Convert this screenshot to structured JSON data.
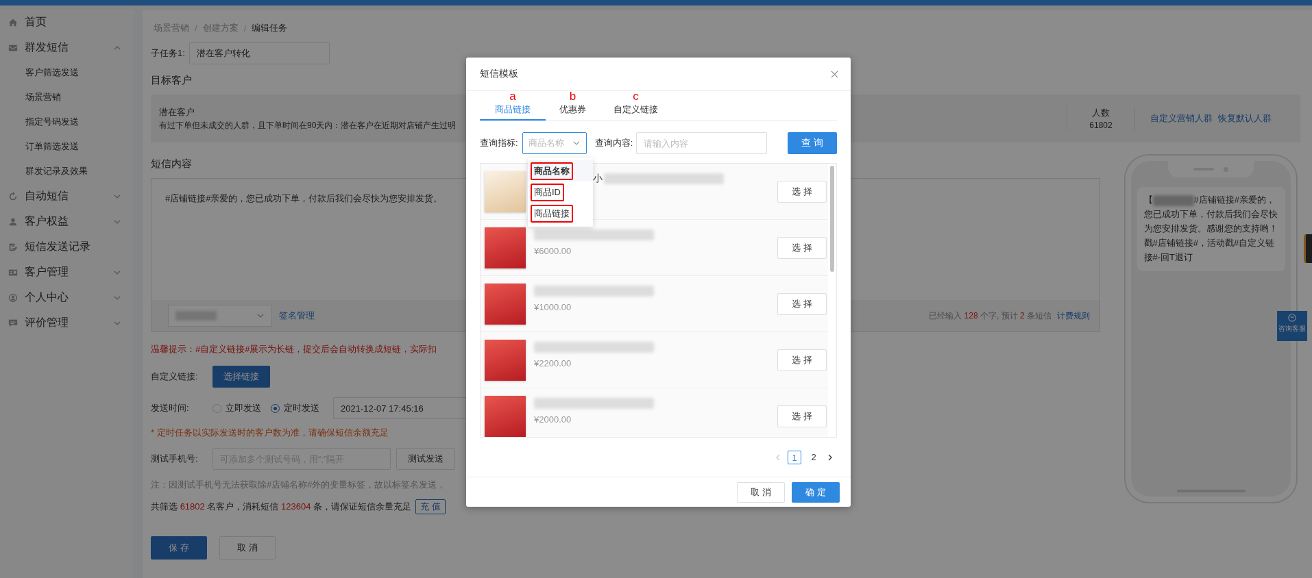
{
  "sidebar": {
    "items": [
      {
        "label": "首页",
        "kind": "link"
      },
      {
        "label": "群发短信",
        "kind": "group",
        "expanded": true,
        "children": [
          {
            "label": "客户筛选发送"
          },
          {
            "label": "场景营销"
          },
          {
            "label": "指定号码发送"
          },
          {
            "label": "订单筛选发送"
          },
          {
            "label": "群发记录及效果"
          }
        ]
      },
      {
        "label": "自动短信",
        "kind": "group",
        "expanded": false
      },
      {
        "label": "客户权益",
        "kind": "group",
        "expanded": false
      },
      {
        "label": "短信发送记录",
        "kind": "link"
      },
      {
        "label": "客户管理",
        "kind": "group",
        "expanded": false
      },
      {
        "label": "个人中心",
        "kind": "group",
        "expanded": false
      },
      {
        "label": "评价管理",
        "kind": "group",
        "expanded": false
      }
    ]
  },
  "breadcrumb": {
    "items": [
      "场景营销",
      "创建方案",
      "编辑任务"
    ],
    "separator": "/"
  },
  "subtask": {
    "label": "子任务1:",
    "value": "潜在客户转化"
  },
  "target": {
    "heading": "目标客户",
    "name": "潜在客户",
    "description": "有过下单但未成交的人群，且下单时间在90天内：潜在客户在近期对店铺产生过明",
    "count_label": "人数",
    "count": "61802",
    "links": [
      "自定义营销人群",
      "恢复默认人群"
    ]
  },
  "content": {
    "heading": "短信内容",
    "text": "#店铺链接#亲爱的，您已成功下单，付款后我们会尽快为您安排发货。",
    "signature_link": "签名管理",
    "counter": [
      {
        "text": "已经输入 ",
        "highlight": false
      },
      {
        "text": "128",
        "highlight": true
      },
      {
        "text": " 个字, 预计 ",
        "highlight": false
      },
      {
        "text": "2",
        "highlight": true
      },
      {
        "text": " 条短信",
        "highlight": false
      }
    ],
    "rules_link": "计费规则"
  },
  "tip": "温馨提示：#自定义链接#展示为长链，提交后会自动转换成短链，实际扣",
  "custom_link": {
    "label": "自定义链接:",
    "button": "选择链接"
  },
  "send_time": {
    "label": "发送时间:",
    "options": [
      {
        "label": "立即发送",
        "selected": false
      },
      {
        "label": "定时发送",
        "selected": true
      }
    ],
    "value": "2021-12-07 17:45:16"
  },
  "schedule_note": "* 定时任务以实际发送时的客户数为准，请确保短信余额充足",
  "test_phone": {
    "label": "测试手机号:",
    "placeholder": "可添加多个测试号码，用“;”隔开",
    "button": "测试发送"
  },
  "test_note": "注：因测试手机号无法获取除#店铺名称#外的变量标签，故以标签名发送，",
  "summary": {
    "parts": [
      {
        "text": "共筛选 ",
        "highlight": false
      },
      {
        "text": "61802",
        "highlight": true
      },
      {
        "text": " 名客户，消耗短信 ",
        "highlight": false
      },
      {
        "text": "123604",
        "highlight": true
      },
      {
        "text": " 条，请保证短信余量充足",
        "highlight": false
      }
    ],
    "button": "充 值"
  },
  "actions": {
    "save": "保 存",
    "cancel": "取 消"
  },
  "phone_preview": {
    "lead": "【",
    "text": "#店铺链接#亲爱的，您已成功下单，付款后我们会尽快为您安排发货。感谢您的支持哟！戳#店铺链接#，活动戳#自定义链接#-回T退订"
  },
  "help_button": "咨询客服",
  "modal": {
    "title": "短信模板",
    "tabs": [
      {
        "label": "商品链接",
        "marker": "a",
        "selected": true
      },
      {
        "label": "优惠券",
        "marker": "b",
        "selected": false
      },
      {
        "label": "自定义链接",
        "marker": "c",
        "selected": false
      }
    ],
    "filter": {
      "label": "查询指标:",
      "placeholder": "商品名称",
      "options": [
        {
          "label": "商品名称",
          "selected": true,
          "annotated": true
        },
        {
          "label": "商品ID",
          "selected": false,
          "annotated": true
        },
        {
          "label": "商品链接",
          "selected": false,
          "annotated": true
        }
      ]
    },
    "query": {
      "label": "查询内容:",
      "placeholder": "请输入内容"
    },
    "search_button": "查 询",
    "products": [
      {
        "name": "小",
        "button": "选 择"
      },
      {
        "price": "¥6000.00",
        "button": "选 择"
      },
      {
        "price": "¥1000.00",
        "button": "选 择"
      },
      {
        "price": "¥2200.00",
        "button": "选 择"
      },
      {
        "price": "¥2000.00",
        "button": "选 择"
      }
    ],
    "pagination": {
      "prev_disabled": true,
      "pages": [
        {
          "label": "1",
          "selected": true
        },
        {
          "label": "2",
          "selected": false
        }
      ]
    },
    "cancel": "取 消",
    "confirm": "确 定"
  }
}
